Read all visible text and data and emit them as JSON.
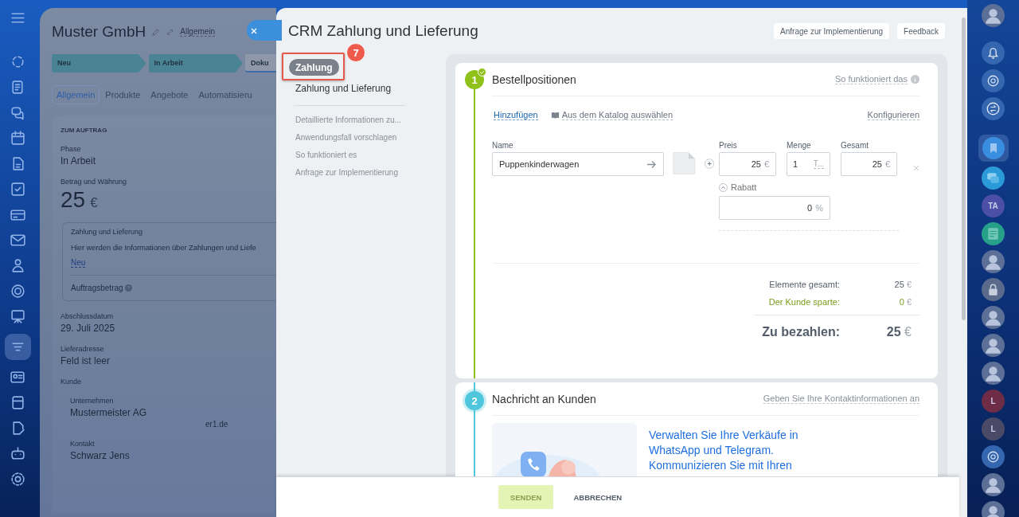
{
  "left_nav": {
    "items": [
      {
        "selected": false
      },
      {
        "selected": false
      },
      {
        "selected": false
      },
      {
        "selected": false
      },
      {
        "selected": false
      },
      {
        "selected": false
      },
      {
        "selected": false
      },
      {
        "selected": false
      },
      {
        "selected": false
      },
      {
        "selected": false
      },
      {
        "selected": false
      },
      {
        "selected": true
      },
      {
        "selected": false
      },
      {
        "selected": false
      },
      {
        "selected": false
      },
      {
        "selected": false
      },
      {
        "selected": false
      }
    ]
  },
  "record": {
    "title": "Muster GmbH",
    "view": "Allgemein",
    "stages": [
      {
        "label": "Neu",
        "done": true
      },
      {
        "label": "In Arbeit",
        "done": true
      },
      {
        "label": "Doku",
        "done": false
      }
    ],
    "tabs": [
      {
        "label": "Allgemein",
        "selected": true
      },
      {
        "label": "Produkte",
        "selected": false
      },
      {
        "label": "Angebote",
        "selected": false
      },
      {
        "label": "Automatisieru",
        "selected": false
      }
    ],
    "section_title": "ZUM AUFTRAG",
    "phase": {
      "label": "Phase",
      "value": "In Arbeit"
    },
    "amount": {
      "label": "Betrag und Währung",
      "value": "25",
      "currency": "€"
    },
    "payment_box": {
      "title": "Zahlung und Lieferung",
      "text": "Hier werden die Informationen über Zahlungen und Liefe",
      "link": "Neu",
      "field": "Auftragsbetrag"
    },
    "fields": [
      {
        "label": "Abschlussdatum",
        "value": "29. Juli 2025"
      },
      {
        "label": "Lieferadresse",
        "value": "Feld ist leer"
      }
    ],
    "client": {
      "label": "Kunde",
      "company_label": "Unternehmen",
      "company": "Mustermeister AG",
      "site": "er1.de",
      "contact_label": "Kontakt",
      "contact": "Schwarz Jens"
    }
  },
  "panel": {
    "title": "CRM Zahlung und Lieferung",
    "header_buttons": [
      "Anfrage zur Implementierung",
      "Feedback"
    ],
    "menu": {
      "items": [
        {
          "label": "Zahlung",
          "kind": "pill",
          "selected": true
        },
        {
          "label": "Zahlung und Lieferung",
          "kind": "item",
          "selected": false
        }
      ],
      "links": [
        "Detaillierte Informationen zu...",
        "Anwendungsfall vorschlagen",
        "So funktioniert es",
        "Anfrage zur Implementierung"
      ]
    },
    "callout": {
      "number": "7"
    },
    "steps": [
      {
        "kind": "products",
        "number": "1",
        "title": "Bestellpositionen",
        "action": "So funktioniert das",
        "done": true,
        "color": "#8ec21a",
        "toolbar": {
          "add": "Hinzufügen",
          "catalog": "Aus dem Katalog auswählen",
          "configure": "Konfigurieren"
        },
        "product": {
          "name_label": "Name",
          "name": "Puppenkinderwagen",
          "price_label": "Preis",
          "price": "25",
          "quantity_label": "Menge",
          "quantity": "1",
          "unit": "T...",
          "total_label": "Gesamt",
          "total": "25",
          "currency": "€",
          "discount_label": "Rabatt",
          "discount": "0",
          "discount_unit": "%"
        },
        "totals": [
          {
            "label": "Elemente gesamt:",
            "value": "25",
            "currency": "€",
            "kind": "plain"
          },
          {
            "label": "Der Kunde sparte:",
            "value": "0",
            "currency": "€",
            "kind": "saving"
          }
        ],
        "due": {
          "label": "Zu bezahlen:",
          "value": "25",
          "currency": "€"
        }
      },
      {
        "kind": "message",
        "number": "2",
        "title": "Nachricht an Kunden",
        "action": "Geben Sie Ihre Kontaktinformationen an",
        "done": false,
        "color": "#4fc6dc",
        "promo": [
          "Verwalten Sie Ihre Verkäufe in",
          "WhatsApp und Telegram.",
          "Kommunizieren Sie mit Ihren"
        ]
      }
    ],
    "footer": [
      {
        "label": "SENDEN",
        "disabled": true
      },
      {
        "label": "ABBRECHEN",
        "disabled": false
      }
    ]
  },
  "right_nav": {
    "items": [
      {
        "kind": "avatar",
        "selected": false
      },
      {
        "kind": "bell",
        "selected": false
      },
      {
        "kind": "target",
        "selected": false
      },
      {
        "kind": "swap",
        "selected": false
      },
      {
        "kind": "bookmark",
        "selected": true
      },
      {
        "kind": "chat",
        "selected": false
      },
      {
        "kind": "initials",
        "text": "TA",
        "color": "#4b4fa6",
        "selected": false
      },
      {
        "kind": "document",
        "selected": false
      },
      {
        "kind": "avatar",
        "selected": false
      },
      {
        "kind": "lock",
        "selected": false
      },
      {
        "kind": "avatar",
        "selected": false
      },
      {
        "kind": "avatar",
        "selected": false
      },
      {
        "kind": "avatar",
        "selected": false
      },
      {
        "kind": "initials",
        "text": "L",
        "color": "#6e2c46",
        "selected": false
      },
      {
        "kind": "initials",
        "text": "L",
        "color": "#4a4a66",
        "selected": false
      },
      {
        "kind": "target",
        "selected": false
      },
      {
        "kind": "avatar",
        "selected": false
      },
      {
        "kind": "avatar",
        "selected": false
      }
    ]
  }
}
